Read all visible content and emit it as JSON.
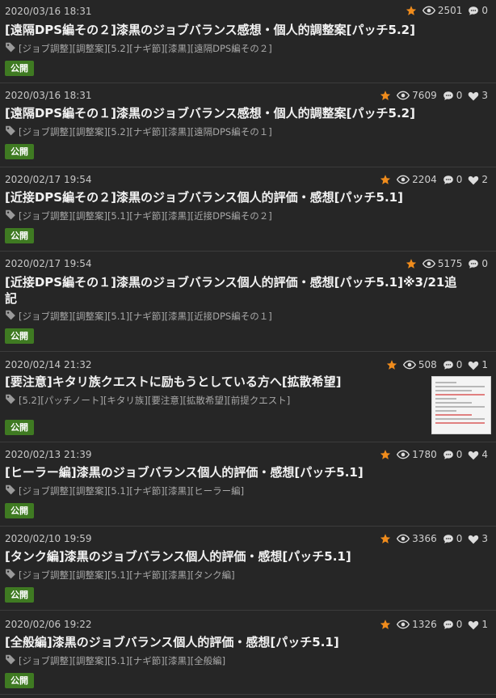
{
  "icons": {
    "star": "star-icon",
    "views": "eye-icon",
    "comments": "comment-icon",
    "likes": "heart-icon",
    "tag": "tag-icon"
  },
  "colors": {
    "star": "#f08c1c",
    "badge": "#3f7a22",
    "background": "#262626"
  },
  "posts": [
    {
      "date": "2020/03/16 18:31",
      "views": "2501",
      "comments": "0",
      "likes": null,
      "title": "[遠隔DPS編その２]漆黒のジョブバランス感想・個人的調整案[パッチ5.2]",
      "tags": "[ジョブ調整][調整案][5.2][ナギ節][漆黒][遠隔DPS編その２]",
      "badge": "公開"
    },
    {
      "date": "2020/03/16 18:31",
      "views": "7609",
      "comments": "0",
      "likes": "3",
      "title": "[遠隔DPS編その１]漆黒のジョブバランス感想・個人的調整案[パッチ5.2]",
      "tags": "[ジョブ調整][調整案][5.2][ナギ節][漆黒][遠隔DPS編その１]",
      "badge": "公開"
    },
    {
      "date": "2020/02/17 19:54",
      "views": "2204",
      "comments": "0",
      "likes": "2",
      "title": "[近接DPS編その２]漆黒のジョブバランス個人的評価・感想[パッチ5.1]",
      "tags": "[ジョブ調整][調整案][5.1][ナギ節][漆黒][近接DPS編その２]",
      "badge": "公開"
    },
    {
      "date": "2020/02/17 19:54",
      "views": "5175",
      "comments": "0",
      "likes": null,
      "title": "[近接DPS編その１]漆黒のジョブバランス個人的評価・感想[パッチ5.1]※3/21追",
      "title2": "記",
      "tags": "[ジョブ調整][調整案][5.1][ナギ節][漆黒][近接DPS編その１]",
      "badge": "公開"
    },
    {
      "date": "2020/02/14 21:32",
      "views": "508",
      "comments": "0",
      "likes": "1",
      "title": "[要注意]キタリ族クエストに励もうとしている方へ[拡散希望]",
      "tags": "[5.2][パッチノート][キタリ族][要注意][拡散希望][前提クエスト]",
      "badge": "公開",
      "thumbnail": true
    },
    {
      "date": "2020/02/13 21:39",
      "views": "1780",
      "comments": "0",
      "likes": "4",
      "title": "[ヒーラー編]漆黒のジョブバランス個人的評価・感想[パッチ5.1]",
      "tags": "[ジョブ調整][調整案][5.1][ナギ節][漆黒][ヒーラー編]",
      "badge": "公開"
    },
    {
      "date": "2020/02/10 19:59",
      "views": "3366",
      "comments": "0",
      "likes": "3",
      "title": "[タンク編]漆黒のジョブバランス個人的評価・感想[パッチ5.1]",
      "tags": "[ジョブ調整][調整案][5.1][ナギ節][漆黒][タンク編]",
      "badge": "公開"
    },
    {
      "date": "2020/02/06 19:22",
      "views": "1326",
      "comments": "0",
      "likes": "1",
      "title": "[全般編]漆黒のジョブバランス個人的評価・感想[パッチ5.1]",
      "tags": "[ジョブ調整][調整案][5.1][ナギ節][漆黒][全般編]",
      "badge": "公開"
    }
  ]
}
